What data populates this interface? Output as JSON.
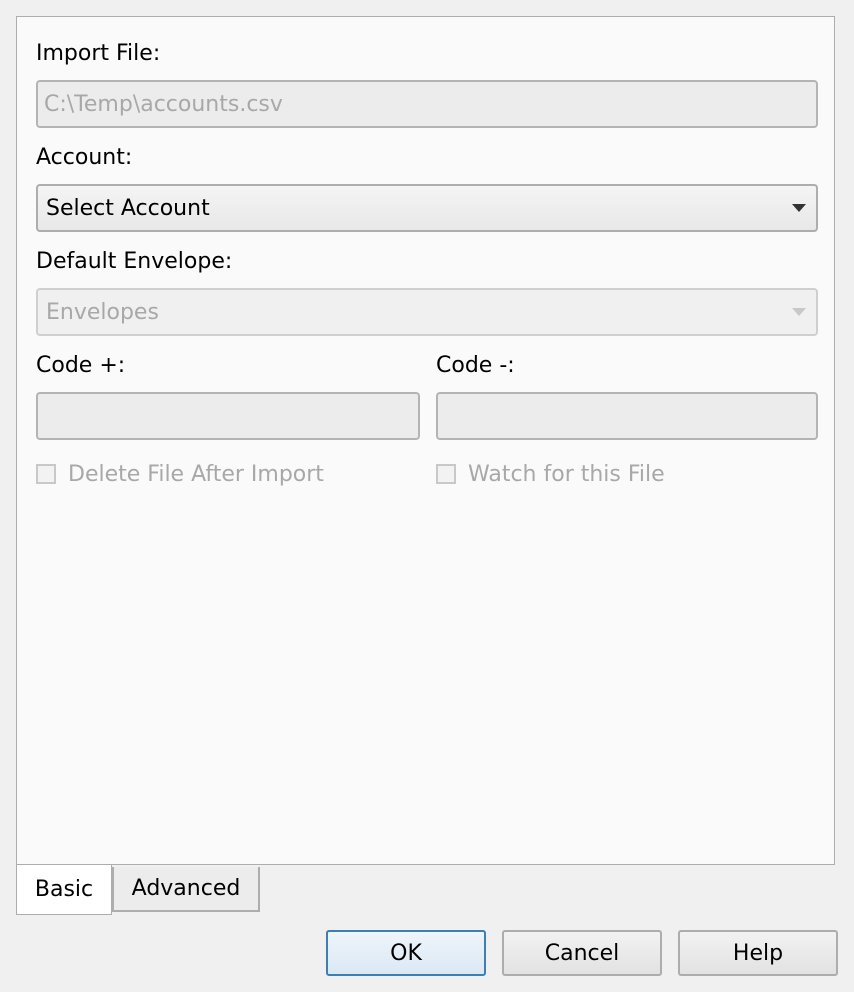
{
  "form": {
    "import_file_label": "Import File:",
    "import_file_value": "C:\\Temp\\accounts.csv",
    "account_label": "Account:",
    "account_selected": "Select Account",
    "default_envelope_label": "Default Envelope:",
    "default_envelope_selected": "Envelopes",
    "code_plus_label": "Code +:",
    "code_plus_value": "",
    "code_minus_label": "Code -:",
    "code_minus_value": "",
    "delete_file_label": "Delete File After Import",
    "delete_file_checked": false,
    "watch_file_label": "Watch for this File",
    "watch_file_checked": false
  },
  "tabs": [
    {
      "label": "Basic",
      "active": true
    },
    {
      "label": "Advanced",
      "active": false
    }
  ],
  "buttons": {
    "ok": "OK",
    "cancel": "Cancel",
    "help": "Help"
  },
  "icons": {
    "dropdown": "chevron-down-icon",
    "checkbox": "checkbox-icon"
  },
  "colors": {
    "default_button_border": "#3c7fb1",
    "disabled_text": "#a8a8a8"
  }
}
